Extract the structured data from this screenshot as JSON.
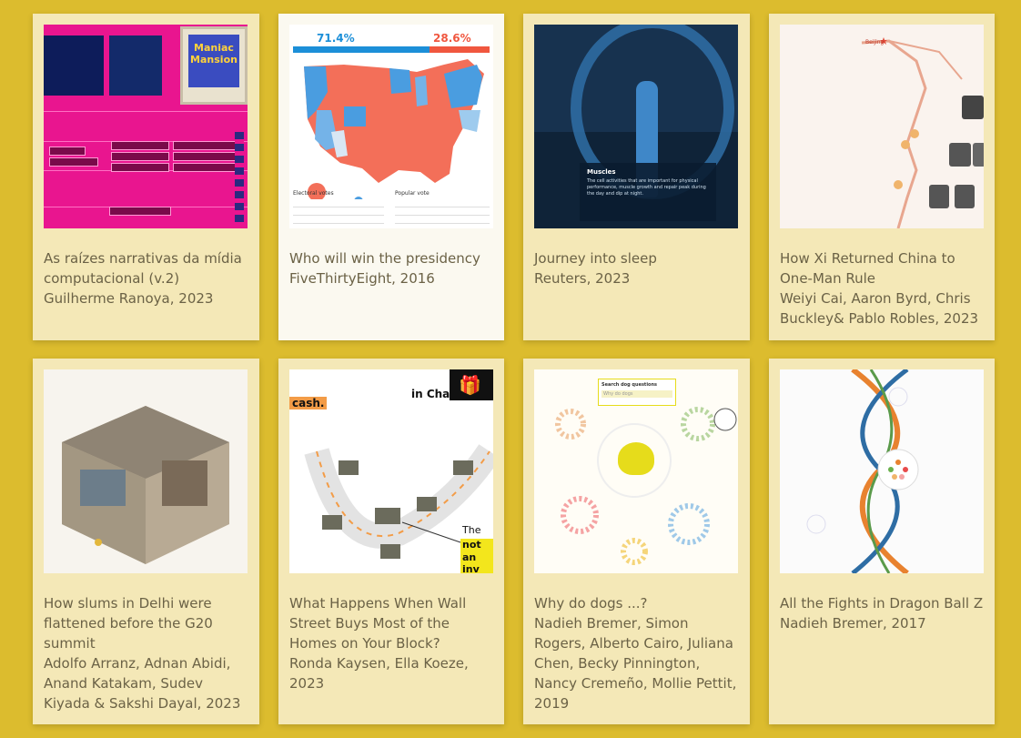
{
  "cards": [
    {
      "title": "As raízes narrativas da mídia computacional (v.2)",
      "author": "Guilherme Ranoya, 2023",
      "thumb": {
        "words": [
          "Maniac",
          "Mansion"
        ]
      }
    },
    {
      "title": "Who will win the presidency",
      "author": "FiveThirtyEight, 2016",
      "thumb": {
        "left_pct": "71.4%",
        "right_pct": "28.6%",
        "legend_left": "Electoral votes",
        "legend_right": "Popular vote"
      }
    },
    {
      "title": "Journey into sleep",
      "author": "Reuters, 2023",
      "thumb": {
        "label": "Muscles",
        "text": "The cell activities that are important for physical performance, muscle growth and repair peak during the day and dip at night."
      }
    },
    {
      "title": "How Xi Returned China to One-Man Rule",
      "author": "Weiyi Cai, Aaron Byrd, Chris Buckley& Pablo Robles, 2023",
      "thumb": {
        "city": "Beijing"
      }
    },
    {
      "title": "How slums in Delhi were flattened before the G20 summit",
      "author": "Adolfo Arranz, Adnan Abidi, Anand Katakam, Sudev Kiyada & Sakshi Dayal, 2023",
      "thumb": {}
    },
    {
      "title": "What Happens When Wall Street Buys Most of the Homes on Your Block?",
      "author": "Ronda Kaysen, Ella Koeze, 2023",
      "thumb": {
        "headline": "in Charlotte",
        "tag": "cash.",
        "callout_1": "The or",
        "callout_2": "not bo",
        "callout_3": "an inv"
      }
    },
    {
      "title": "Why do dogs ...?",
      "author": "Nadieh Bremer, Simon Rogers, Alberto Cairo, Juliana Chen, Becky Pinnington, Nancy Cremeño, Mollie Pettit, 2019",
      "thumb": {
        "search_label": "Search dog questions",
        "search_placeholder": "Why do dogs"
      }
    },
    {
      "title": "All the Fights in Dragon Ball Z",
      "author": "Nadieh Bremer, 2017",
      "thumb": {}
    }
  ],
  "colors": {
    "background": "#dcbc2e",
    "card": "#f4e8b7",
    "text": "#6b6246"
  }
}
